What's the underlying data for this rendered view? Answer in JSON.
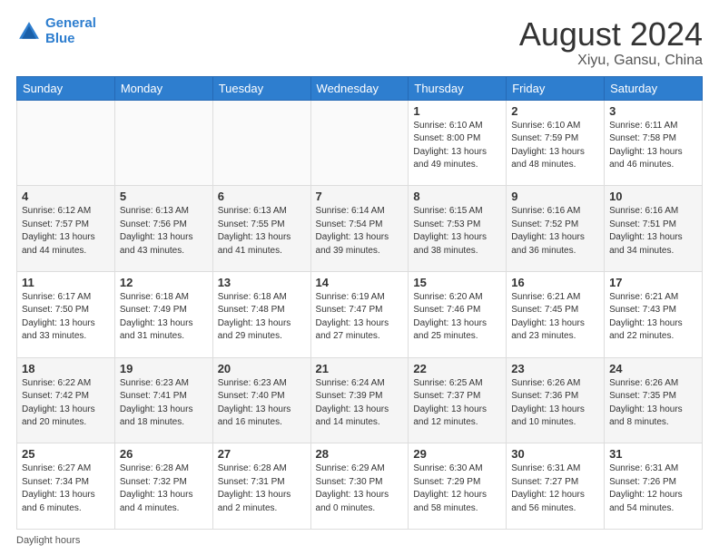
{
  "header": {
    "logo_line1": "General",
    "logo_line2": "Blue",
    "month_year": "August 2024",
    "location": "Xiyu, Gansu, China"
  },
  "days_of_week": [
    "Sunday",
    "Monday",
    "Tuesday",
    "Wednesday",
    "Thursday",
    "Friday",
    "Saturday"
  ],
  "footer_text": "Daylight hours",
  "weeks": [
    [
      {
        "day": "",
        "info": ""
      },
      {
        "day": "",
        "info": ""
      },
      {
        "day": "",
        "info": ""
      },
      {
        "day": "",
        "info": ""
      },
      {
        "day": "1",
        "info": "Sunrise: 6:10 AM\nSunset: 8:00 PM\nDaylight: 13 hours\nand 49 minutes."
      },
      {
        "day": "2",
        "info": "Sunrise: 6:10 AM\nSunset: 7:59 PM\nDaylight: 13 hours\nand 48 minutes."
      },
      {
        "day": "3",
        "info": "Sunrise: 6:11 AM\nSunset: 7:58 PM\nDaylight: 13 hours\nand 46 minutes."
      }
    ],
    [
      {
        "day": "4",
        "info": "Sunrise: 6:12 AM\nSunset: 7:57 PM\nDaylight: 13 hours\nand 44 minutes."
      },
      {
        "day": "5",
        "info": "Sunrise: 6:13 AM\nSunset: 7:56 PM\nDaylight: 13 hours\nand 43 minutes."
      },
      {
        "day": "6",
        "info": "Sunrise: 6:13 AM\nSunset: 7:55 PM\nDaylight: 13 hours\nand 41 minutes."
      },
      {
        "day": "7",
        "info": "Sunrise: 6:14 AM\nSunset: 7:54 PM\nDaylight: 13 hours\nand 39 minutes."
      },
      {
        "day": "8",
        "info": "Sunrise: 6:15 AM\nSunset: 7:53 PM\nDaylight: 13 hours\nand 38 minutes."
      },
      {
        "day": "9",
        "info": "Sunrise: 6:16 AM\nSunset: 7:52 PM\nDaylight: 13 hours\nand 36 minutes."
      },
      {
        "day": "10",
        "info": "Sunrise: 6:16 AM\nSunset: 7:51 PM\nDaylight: 13 hours\nand 34 minutes."
      }
    ],
    [
      {
        "day": "11",
        "info": "Sunrise: 6:17 AM\nSunset: 7:50 PM\nDaylight: 13 hours\nand 33 minutes."
      },
      {
        "day": "12",
        "info": "Sunrise: 6:18 AM\nSunset: 7:49 PM\nDaylight: 13 hours\nand 31 minutes."
      },
      {
        "day": "13",
        "info": "Sunrise: 6:18 AM\nSunset: 7:48 PM\nDaylight: 13 hours\nand 29 minutes."
      },
      {
        "day": "14",
        "info": "Sunrise: 6:19 AM\nSunset: 7:47 PM\nDaylight: 13 hours\nand 27 minutes."
      },
      {
        "day": "15",
        "info": "Sunrise: 6:20 AM\nSunset: 7:46 PM\nDaylight: 13 hours\nand 25 minutes."
      },
      {
        "day": "16",
        "info": "Sunrise: 6:21 AM\nSunset: 7:45 PM\nDaylight: 13 hours\nand 23 minutes."
      },
      {
        "day": "17",
        "info": "Sunrise: 6:21 AM\nSunset: 7:43 PM\nDaylight: 13 hours\nand 22 minutes."
      }
    ],
    [
      {
        "day": "18",
        "info": "Sunrise: 6:22 AM\nSunset: 7:42 PM\nDaylight: 13 hours\nand 20 minutes."
      },
      {
        "day": "19",
        "info": "Sunrise: 6:23 AM\nSunset: 7:41 PM\nDaylight: 13 hours\nand 18 minutes."
      },
      {
        "day": "20",
        "info": "Sunrise: 6:23 AM\nSunset: 7:40 PM\nDaylight: 13 hours\nand 16 minutes."
      },
      {
        "day": "21",
        "info": "Sunrise: 6:24 AM\nSunset: 7:39 PM\nDaylight: 13 hours\nand 14 minutes."
      },
      {
        "day": "22",
        "info": "Sunrise: 6:25 AM\nSunset: 7:37 PM\nDaylight: 13 hours\nand 12 minutes."
      },
      {
        "day": "23",
        "info": "Sunrise: 6:26 AM\nSunset: 7:36 PM\nDaylight: 13 hours\nand 10 minutes."
      },
      {
        "day": "24",
        "info": "Sunrise: 6:26 AM\nSunset: 7:35 PM\nDaylight: 13 hours\nand 8 minutes."
      }
    ],
    [
      {
        "day": "25",
        "info": "Sunrise: 6:27 AM\nSunset: 7:34 PM\nDaylight: 13 hours\nand 6 minutes."
      },
      {
        "day": "26",
        "info": "Sunrise: 6:28 AM\nSunset: 7:32 PM\nDaylight: 13 hours\nand 4 minutes."
      },
      {
        "day": "27",
        "info": "Sunrise: 6:28 AM\nSunset: 7:31 PM\nDaylight: 13 hours\nand 2 minutes."
      },
      {
        "day": "28",
        "info": "Sunrise: 6:29 AM\nSunset: 7:30 PM\nDaylight: 13 hours\nand 0 minutes."
      },
      {
        "day": "29",
        "info": "Sunrise: 6:30 AM\nSunset: 7:29 PM\nDaylight: 12 hours\nand 58 minutes."
      },
      {
        "day": "30",
        "info": "Sunrise: 6:31 AM\nSunset: 7:27 PM\nDaylight: 12 hours\nand 56 minutes."
      },
      {
        "day": "31",
        "info": "Sunrise: 6:31 AM\nSunset: 7:26 PM\nDaylight: 12 hours\nand 54 minutes."
      }
    ]
  ]
}
